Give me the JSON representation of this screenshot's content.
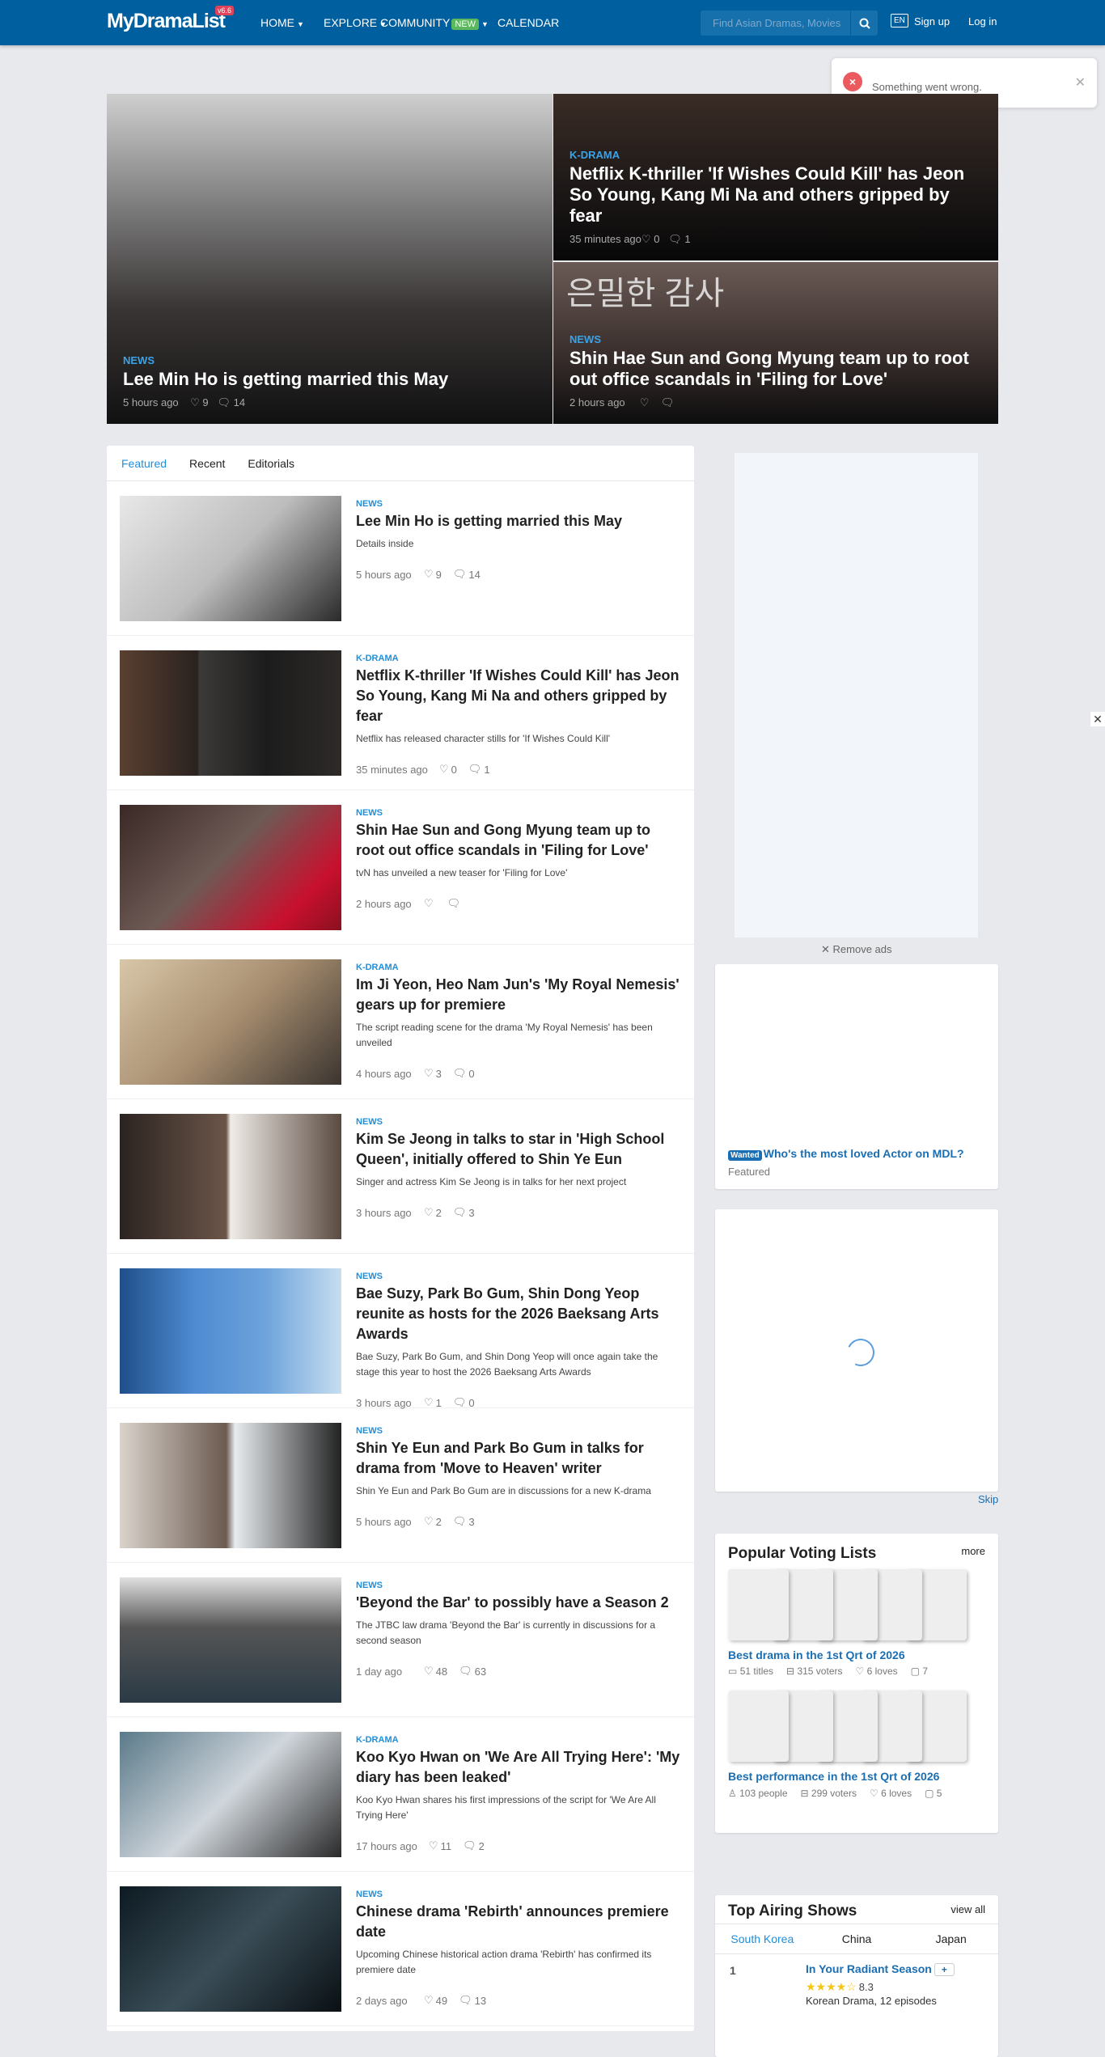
{
  "header": {
    "logo": "MyDramaList",
    "version": "v6.6",
    "nav": [
      {
        "label": "HOME",
        "caret": true
      },
      {
        "label": "EXPLORE",
        "caret": true
      },
      {
        "label": "COMMUNITY",
        "badge": "NEW",
        "caret": true
      },
      {
        "label": "CALENDAR",
        "caret": false
      }
    ],
    "search_placeholder": "Find Asian Dramas, Movies",
    "lang": "EN",
    "signup": "Sign up",
    "login": "Log in"
  },
  "toast": {
    "message": "Something went wrong."
  },
  "hero": [
    {
      "category": "NEWS",
      "title": "Lee Min Ho is getting married this May",
      "time": "5 hours ago",
      "likes": "9",
      "comments": "14"
    },
    {
      "category": "K-DRAMA",
      "title": "Netflix K-thriller 'If Wishes Could Kill' has Jeon So Young, Kang Mi Na and others gripped by fear",
      "time": "35 minutes ago",
      "likes": "0",
      "comments": "1"
    },
    {
      "category": "NEWS",
      "title": "Shin Hae Sun and Gong Myung team up to root out office scandals in 'Filing for Love'",
      "time": "2 hours ago",
      "likes": "",
      "comments": "",
      "overlay": "은밀한 감사"
    }
  ],
  "tabs": [
    "Featured",
    "Recent",
    "Editorials"
  ],
  "articles": [
    {
      "category": "NEWS",
      "title": "Lee Min Ho is getting married this May",
      "desc": "Details inside",
      "time": "5 hours ago",
      "likes": "9",
      "comments": "14"
    },
    {
      "category": "K-DRAMA",
      "title": "Netflix K-thriller 'If Wishes Could Kill' has Jeon So Young, Kang Mi Na and others gripped by fear",
      "desc": "Netflix has released character stills for 'If Wishes Could Kill'",
      "time": "35 minutes ago",
      "likes": "0",
      "comments": "1"
    },
    {
      "category": "NEWS",
      "title": "Shin Hae Sun and Gong Myung team up to root out office scandals in 'Filing for Love'",
      "desc": "tvN has unveiled a new teaser for 'Filing for Love'",
      "time": "2 hours ago",
      "likes": "",
      "comments": ""
    },
    {
      "category": "K-DRAMA",
      "title": "Im Ji Yeon, Heo Nam Jun's 'My Royal Nemesis' gears up for premiere",
      "desc": "The script reading scene for the drama 'My Royal Nemesis' has been unveiled",
      "time": "4 hours ago",
      "likes": "3",
      "comments": "0"
    },
    {
      "category": "NEWS",
      "title": "Kim Se Jeong in talks to star in 'High School Queen', initially offered to Shin Ye Eun",
      "desc": "Singer and actress Kim Se Jeong is in talks for her next project",
      "time": "3 hours ago",
      "likes": "2",
      "comments": "3"
    },
    {
      "category": "NEWS",
      "title": "Bae Suzy, Park Bo Gum, Shin Dong Yeop reunite as hosts for the 2026 Baeksang Arts Awards",
      "desc": "Bae Suzy, Park Bo Gum, and Shin Dong Yeop will once again take the stage this year to host the 2026 Baeksang Arts Awards",
      "time": "3 hours ago",
      "likes": "1",
      "comments": "0"
    },
    {
      "category": "NEWS",
      "title": "Shin Ye Eun and Park Bo Gum in talks for drama from 'Move to Heaven' writer",
      "desc": "Shin Ye Eun and Park Bo Gum are in discussions for a new K-drama",
      "time": "5 hours ago",
      "likes": "2",
      "comments": "3"
    },
    {
      "category": "NEWS",
      "title": "'Beyond the Bar' to possibly have a Season 2",
      "desc": "The JTBC law drama 'Beyond the Bar' is currently in discussions for a second season",
      "time": "1 day ago",
      "likes": "48",
      "comments": "63"
    },
    {
      "category": "K-DRAMA",
      "title": "Koo Kyo Hwan on 'We Are All Trying Here': 'My diary has been leaked'",
      "desc": "Koo Kyo Hwan shares his first impressions of the script for 'We Are All Trying Here'",
      "time": "17 hours ago",
      "likes": "11",
      "comments": "2"
    },
    {
      "category": "NEWS",
      "title": "Chinese drama 'Rebirth' announces premiere date",
      "desc": "Upcoming Chinese historical action drama 'Rebirth' has confirmed its premiere date",
      "time": "2 days ago",
      "likes": "49",
      "comments": "13"
    }
  ],
  "sidebar": {
    "remove_ads": "Remove ads",
    "wanted": {
      "tag": "Wanted",
      "title": "Who's the most loved Actor on MDL?",
      "sub": "Featured"
    },
    "skip": "Skip",
    "voting": {
      "title": "Popular Voting Lists",
      "more": "more",
      "lists": [
        {
          "title": "Best drama in the 1st Qrt of 2026",
          "stats": [
            "51 titles",
            "315 voters",
            "6 loves",
            "7"
          ]
        },
        {
          "title": "Best performance in the 1st Qrt of 2026",
          "stats": [
            "103 people",
            "299 voters",
            "6 loves",
            "5"
          ]
        }
      ]
    },
    "airing": {
      "title": "Top Airing Shows",
      "view_all": "view all",
      "tabs": [
        "South Korea",
        "China",
        "Japan"
      ],
      "shows": [
        {
          "rank": "1",
          "title": "In Your Radiant Season",
          "add": "+",
          "rating": "8.3",
          "stars": 4,
          "sub": "Korean Drama, 12 episodes"
        }
      ]
    }
  }
}
